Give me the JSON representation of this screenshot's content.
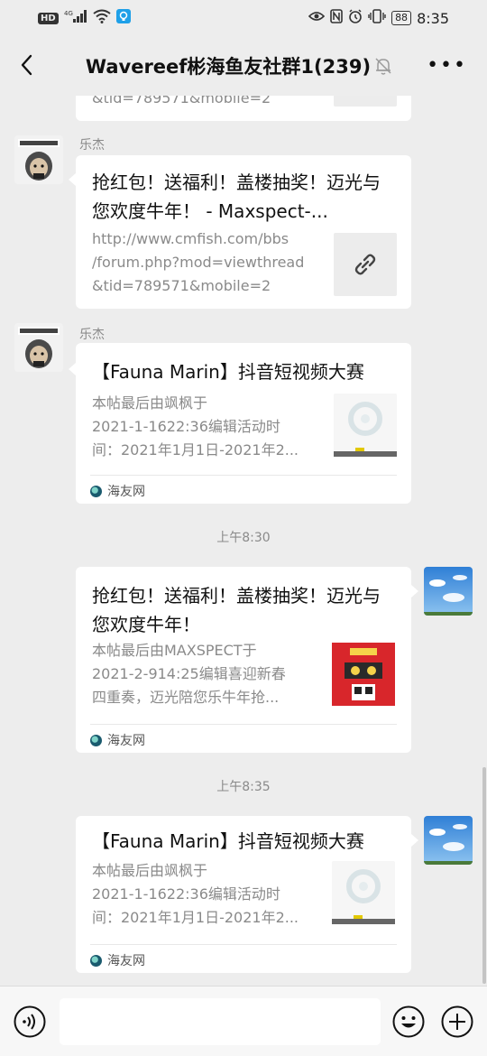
{
  "status_bar": {
    "left_icons": [
      "hd-icon",
      "signal-4g-icon",
      "wifi-icon",
      "app-notification-icon"
    ],
    "hd_label": "HD",
    "network_label": "4G",
    "right_icons": [
      "eye-icon",
      "nfc-icon",
      "alarm-icon",
      "vibrate-icon",
      "battery-icon"
    ],
    "battery": "88",
    "time": "8:35"
  },
  "nav": {
    "title": "Wavereef彬海鱼友社群1(239)",
    "back_icon": "chevron-left-icon",
    "mute_icon": "bell-muted-icon",
    "more_icon": "more-dots-icon",
    "more_label": "•••"
  },
  "messages": [
    {
      "type": "link-partial",
      "visible_tail": "&tid=789571&mobile=2"
    },
    {
      "sender": "乐杰",
      "type": "link",
      "title": "抢红包！送福利！盖楼抽奖！迈光与您欢度牛年！ - Maxspect-...",
      "desc_lines": [
        "http://www.cmfish.com/bbs",
        "/forum.php?mod=viewthread",
        "&tid=789571&mobile=2"
      ],
      "thumb_icon": "link-icon"
    },
    {
      "sender": "乐杰",
      "type": "article",
      "title": "【Fauna Marin】抖音短视频大赛",
      "desc_lines": [
        "本帖最后由飒枫于",
        "2021-1-1622:36编辑活动时",
        "间：2021年1月1日-2021年2..."
      ],
      "source": "海友网"
    },
    {
      "type": "timestamp",
      "text": "上午8:30"
    },
    {
      "type": "article-self",
      "title": "抢红包！送福利！盖楼抽奖！迈光与您欢度牛年！",
      "desc_lines": [
        "本帖最后由MAXSPECT于",
        "2021-2-914:25编辑喜迎新春",
        "四重奏，迈光陪您乐牛年抢..."
      ],
      "source": "海友网"
    },
    {
      "type": "timestamp",
      "text": "上午8:35"
    },
    {
      "type": "article-self",
      "title": "【Fauna Marin】抖音短视频大赛",
      "desc_lines": [
        "本帖最后由飒枫于",
        "2021-1-1622:36编辑活动时",
        "间：2021年1月1日-2021年2..."
      ],
      "source": "海友网"
    }
  ],
  "input_bar": {
    "voice_icon": "voice-icon",
    "emoji_icon": "emoji-icon",
    "plus_icon": "plus-icon",
    "text_value": ""
  },
  "colors": {
    "background": "#ededed",
    "card": "#ffffff",
    "secondary_text": "#8a8a8a",
    "red_envelope": "#d8262b"
  }
}
